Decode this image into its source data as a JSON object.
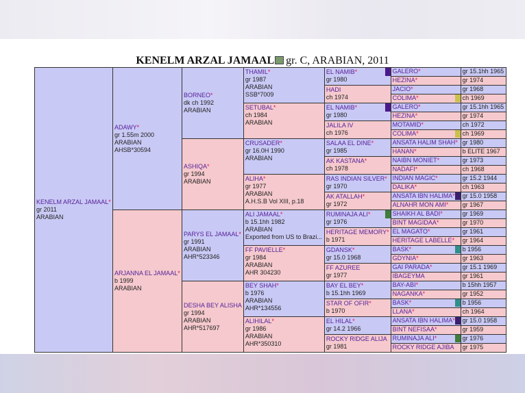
{
  "title": {
    "name": "KENELM ARZAL JAMAAL",
    "details": "gr. C, ARABIAN, 2011"
  },
  "subject": {
    "name": "KENELM ARZAL JAMAAL",
    "star": "*",
    "lines": [
      "gr 2011",
      "ARABIAN"
    ]
  },
  "gen1": {
    "sire": {
      "name": "ADAWY",
      "star": "*",
      "lines": [
        "gr 1.55m 2000",
        "ARABIAN",
        "AHSB*30594"
      ]
    },
    "dam": {
      "name": "ARJANNA EL JAMAAL",
      "star": "*",
      "lines": [
        "b 1999",
        "ARABIAN"
      ]
    }
  },
  "gen2": [
    {
      "name": "BORNEO",
      "star": "*",
      "lines": [
        "dk ch 1992",
        "ARABIAN"
      ]
    },
    {
      "name": "ASHIQA",
      "star": "*",
      "lines": [
        "gr 1994",
        "ARABIAN"
      ]
    },
    {
      "name": "PARYS EL JAMAAL",
      "star": "*",
      "lines": [
        "gr 1991",
        "ARABIAN",
        "AHR*523346"
      ]
    },
    {
      "name": "DESHA BEY ALISHA",
      "star": "",
      "lines": [
        "gr 1994",
        "ARABIAN",
        "AHR*517697"
      ]
    }
  ],
  "gen3": [
    {
      "name": "THAMIL",
      "star": "*",
      "lines": [
        "gr 1987",
        "ARABIAN",
        "SSB*7009"
      ]
    },
    {
      "name": "SETUBAL",
      "star": "*",
      "lines": [
        "ch 1984",
        "ARABIAN"
      ]
    },
    {
      "name": "CRUSADER",
      "star": "*",
      "lines": [
        "gr 16.0H 1990",
        "ARABIAN"
      ]
    },
    {
      "name": "ALIHA",
      "star": "*",
      "lines": [
        "gr 1977",
        "ARABIAN",
        "A.H.S.B Vol XIII, p.18"
      ]
    },
    {
      "name": "ALI JAMAAL",
      "star": "*",
      "lines": [
        "b 15.1hh 1982",
        "ARABIAN",
        "Exported from US to Brazi..."
      ]
    },
    {
      "name": "FF PAVIELLE",
      "star": "*",
      "lines": [
        "gr 1984",
        "ARABIAN",
        "AHR 304230"
      ]
    },
    {
      "name": "BEY SHAH",
      "star": "*",
      "lines": [
        "b 1976",
        "ARABIAN",
        "AHR*134556"
      ]
    },
    {
      "name": "ALIHILAL",
      "star": "*",
      "lines": [
        "gr 1986",
        "ARABIAN",
        "AHR*350310"
      ]
    }
  ],
  "gen4": [
    {
      "name": "EL NAMIB",
      "star": "*",
      "line": "gr 1980",
      "mark": "#4b1a8a"
    },
    {
      "name": "HADI",
      "star": "",
      "line": "ch 1974",
      "mark": ""
    },
    {
      "name": "EL NAMIB",
      "star": "*",
      "line": "gr 1980",
      "mark": "#4b1a8a"
    },
    {
      "name": "JALILA IV",
      "star": "",
      "line": "ch 1976",
      "mark": ""
    },
    {
      "name": "SALAA EL DINE",
      "star": "*",
      "line": "gr 1985",
      "mark": ""
    },
    {
      "name": "AK KASTANA",
      "star": "*",
      "line": "ch 1978",
      "mark": ""
    },
    {
      "name": "RAS INDIAN SILVER",
      "star": "*",
      "line": "gr 1970",
      "mark": ""
    },
    {
      "name": "AK ATALLAH",
      "star": "*",
      "line": "gr 1972",
      "mark": ""
    },
    {
      "name": "RUMINAJA ALI",
      "star": "*",
      "line": "gr 1976",
      "mark": "#3f7d3a"
    },
    {
      "name": "HERITAGE MEMORY",
      "star": "*",
      "line": "b 1971",
      "mark": ""
    },
    {
      "name": "GDANSK",
      "star": "*",
      "line": "gr 15.0 1968",
      "mark": ""
    },
    {
      "name": "FF AZUREE",
      "star": "",
      "line": "gr 1977",
      "mark": ""
    },
    {
      "name": "BAY EL BEY",
      "star": "*",
      "line": "b 15.1hh 1969",
      "mark": ""
    },
    {
      "name": "STAR OF OFIR",
      "star": "*",
      "line": "b 1970",
      "mark": ""
    },
    {
      "name": "EL HILAL",
      "star": "*",
      "line": "gr 14.2 1966",
      "mark": ""
    },
    {
      "name": "ROCKY RIDGE ALIJA",
      "star": "",
      "line": "gr 1981",
      "mark": ""
    }
  ],
  "gen5": [
    {
      "name": "GALERO",
      "star": "*",
      "info": "gr 15.1hh 1965",
      "mark": ""
    },
    {
      "name": "HEZINA",
      "star": "*",
      "info": "gr 1974",
      "mark": ""
    },
    {
      "name": "JACIO",
      "star": "*",
      "info": "gr 1968",
      "mark": ""
    },
    {
      "name": "COLIMA",
      "star": "*",
      "info": "ch 1969",
      "mark": "#c9c24a"
    },
    {
      "name": "GALERO",
      "star": "*",
      "info": "gr 15.1hh 1965",
      "mark": ""
    },
    {
      "name": "HEZINA",
      "star": "*",
      "info": "gr 1974",
      "mark": ""
    },
    {
      "name": "MOTAMID",
      "star": "*",
      "info": "ch 1972",
      "mark": ""
    },
    {
      "name": "COLIMA",
      "star": "*",
      "info": "ch 1969",
      "mark": "#c9c24a"
    },
    {
      "name": "ANSATA HALIM SHAH",
      "star": "*",
      "info": "gr 1980",
      "mark": ""
    },
    {
      "name": "HANAN",
      "star": "*",
      "info": "b ELITE 1967",
      "mark": ""
    },
    {
      "name": "NAIBN MONIET",
      "star": "*",
      "info": "gr 1973",
      "mark": ""
    },
    {
      "name": "NADAFI",
      "star": "*",
      "info": "ch 1968",
      "mark": ""
    },
    {
      "name": "INDIAN MAGIC",
      "star": "*",
      "info": "gr 15.2 1944",
      "mark": ""
    },
    {
      "name": "DALIKA",
      "star": "*",
      "info": "ch 1963",
      "mark": ""
    },
    {
      "name": "ANSATA IBN HALIMA",
      "star": "*",
      "info": "gr 15.0 1958",
      "mark": "#3a1f6e"
    },
    {
      "name": "ALNAHR MON AMI",
      "star": "*",
      "info": "gr 1967",
      "mark": ""
    },
    {
      "name": "SHAIKH AL BADI",
      "star": "*",
      "info": "gr 1969",
      "mark": ""
    },
    {
      "name": "BINT MAGIDAA",
      "star": "*",
      "info": "gr 1970",
      "mark": ""
    },
    {
      "name": "EL MAGATO",
      "star": "*",
      "info": "gr 1961",
      "mark": ""
    },
    {
      "name": "HERITAGE LABELLE",
      "star": "*",
      "info": "gr 1964",
      "mark": ""
    },
    {
      "name": "BASK",
      "star": "*",
      "info": "b 1956",
      "mark": "#2f8f8a"
    },
    {
      "name": "GDYNIA",
      "star": "*",
      "info": "gr 1963",
      "mark": ""
    },
    {
      "name": "GAI PARADA",
      "star": "*",
      "info": "gr 15.1 1969",
      "mark": ""
    },
    {
      "name": "IBAGEYMA",
      "star": "",
      "info": "gr 1961",
      "mark": ""
    },
    {
      "name": "BAY-ABI",
      "star": "*",
      "info": "b 15hh 1957",
      "mark": ""
    },
    {
      "name": "NAGANKA",
      "star": "*",
      "info": "gr 1952",
      "mark": ""
    },
    {
      "name": "BASK",
      "star": "*",
      "info": "b 1956",
      "mark": "#2f8f8a"
    },
    {
      "name": "LLANA",
      "star": "*",
      "info": "ch 1964",
      "mark": ""
    },
    {
      "name": "ANSATA IBN HALIMA",
      "star": "*",
      "info": "gr 15.0 1958",
      "mark": "#3a1f6e"
    },
    {
      "name": "BINT NEFISAA",
      "star": "*",
      "info": "gr 1959",
      "mark": ""
    },
    {
      "name": "RUMINAJA ALI",
      "star": "*",
      "info": "gr 1976",
      "mark": "#3f7d3a"
    },
    {
      "name": "ROCKY RIDGE AJIBA",
      "star": "",
      "info": "gr 1975",
      "mark": ""
    }
  ]
}
